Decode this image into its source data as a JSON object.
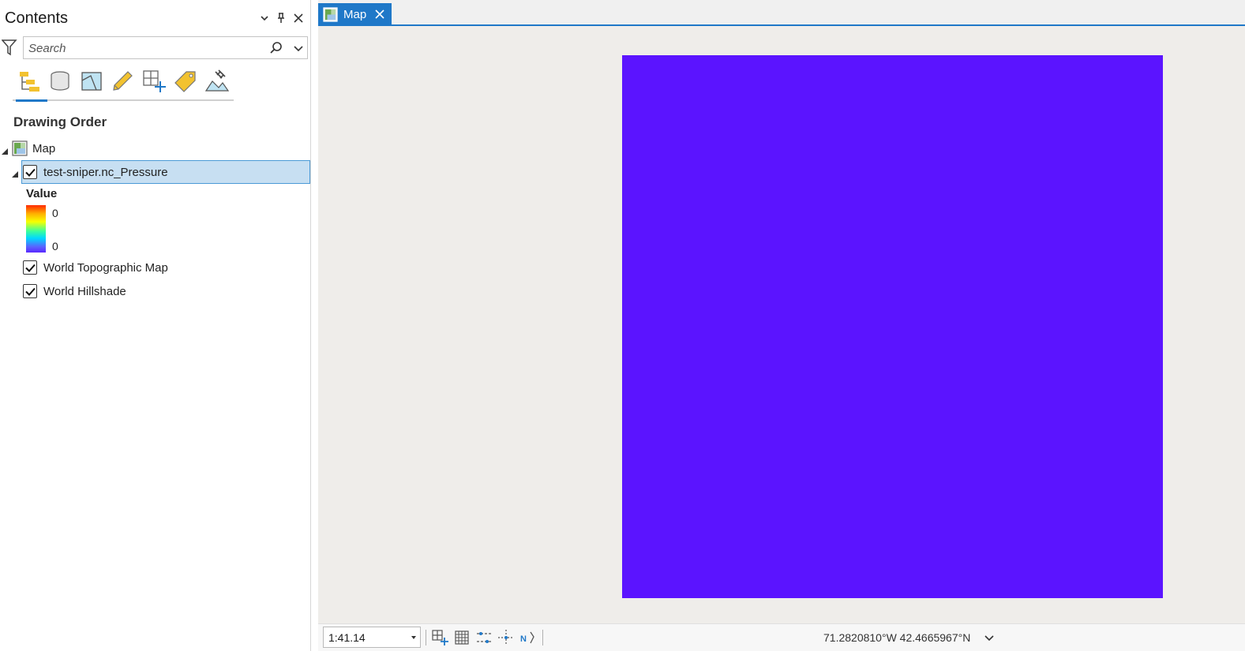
{
  "contents": {
    "title": "Contents",
    "search_placeholder": "Search",
    "section_title": "Drawing Order",
    "tabs": [
      {
        "name": "list-by-drawing-order-icon"
      },
      {
        "name": "list-by-data-source-icon"
      },
      {
        "name": "list-by-selection-icon"
      },
      {
        "name": "list-by-editing-icon"
      },
      {
        "name": "list-by-snapping-icon"
      },
      {
        "name": "list-by-labeling-icon"
      },
      {
        "name": "list-by-perspective-imagery-icon"
      }
    ],
    "tree": {
      "map_label": "Map",
      "layer_label": "test-sniper.nc_Pressure",
      "legend_heading": "Value",
      "legend_high": "0",
      "legend_low": "0",
      "basemap_1": "World Topographic Map",
      "basemap_2": "World Hillshade"
    }
  },
  "map_view": {
    "tab_label": "Map",
    "raster_color": "#5b14ff",
    "scale": "1:41.14",
    "coordinates": "71.2820810°W 42.4665967°N"
  },
  "colors": {
    "accent": "#1f78c8",
    "selection": "#c7dff2"
  }
}
